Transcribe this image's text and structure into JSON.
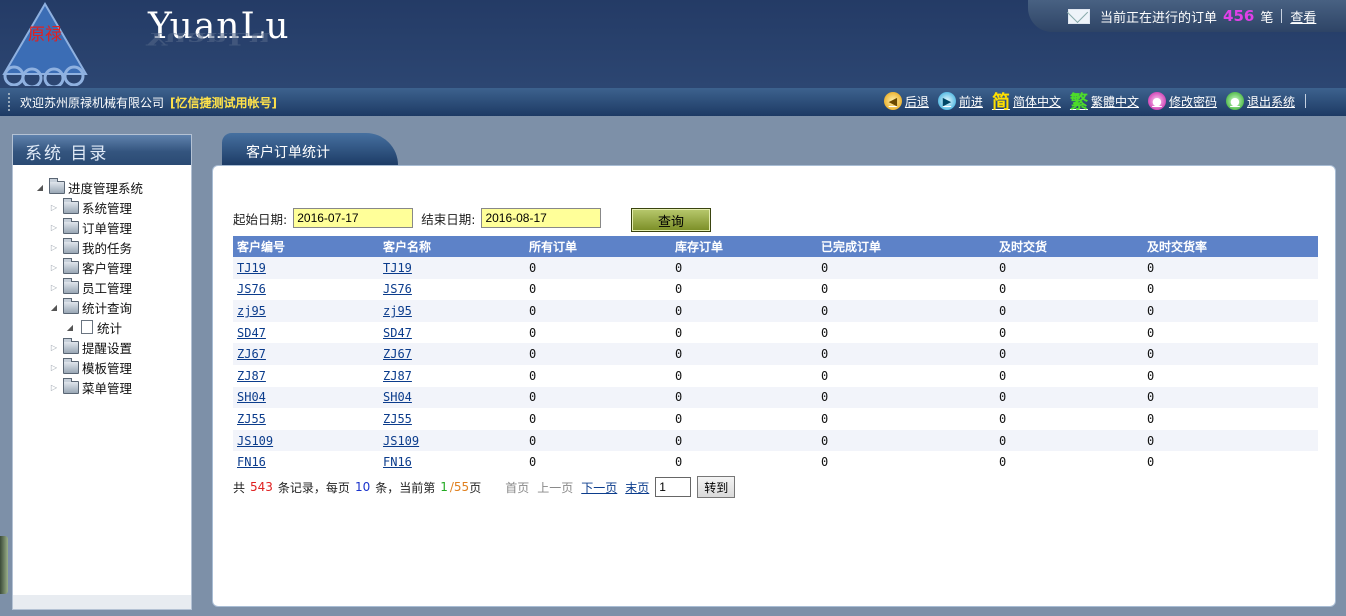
{
  "header": {
    "logo_text": "原禄",
    "brand": "YuanLu",
    "notice": {
      "text": "当前正在进行的订单",
      "count": "456",
      "unit": "笔",
      "view_link": "查看"
    }
  },
  "navbar": {
    "welcome": "欢迎苏州原禄机械有限公司",
    "account": "[忆信捷测试用帐号]",
    "links": {
      "back": "后退",
      "forward": "前进",
      "simplified_icon": "简",
      "simplified": "简体中文",
      "traditional_icon": "繁",
      "traditional": "繁體中文",
      "change_password": "修改密码",
      "logout": "退出系统"
    }
  },
  "sidebar": {
    "title": "系统 目录",
    "root": "进度管理系统",
    "items": {
      "system": "系统管理",
      "orders": "订单管理",
      "tasks": "我的任务",
      "customers": "客户管理",
      "staff": "员工管理",
      "stats": "统计查询",
      "stats_child": "统计",
      "reminders": "提醒设置",
      "templates": "模板管理",
      "menus": "菜单管理"
    }
  },
  "tab": {
    "label": "客户订单统计"
  },
  "filter": {
    "start_label": "起始日期:",
    "start_value": "2016-07-17",
    "end_label": "结束日期:",
    "end_value": "2016-08-17",
    "query_button": "查询"
  },
  "table": {
    "headers": {
      "code": "客户编号",
      "name": "客户名称",
      "all": "所有订单",
      "stock": "库存订单",
      "done": "已完成订单",
      "ontime": "及时交货",
      "rate": "及时交货率"
    },
    "rows": [
      {
        "code": "TJ19",
        "name": "TJ19",
        "all": "0",
        "stock": "0",
        "done": "0",
        "ontime": "0",
        "rate": "0"
      },
      {
        "code": "JS76",
        "name": "JS76",
        "all": "0",
        "stock": "0",
        "done": "0",
        "ontime": "0",
        "rate": "0"
      },
      {
        "code": "zj95",
        "name": "zj95",
        "all": "0",
        "stock": "0",
        "done": "0",
        "ontime": "0",
        "rate": "0"
      },
      {
        "code": "SD47",
        "name": "SD47",
        "all": "0",
        "stock": "0",
        "done": "0",
        "ontime": "0",
        "rate": "0"
      },
      {
        "code": "ZJ67",
        "name": "ZJ67",
        "all": "0",
        "stock": "0",
        "done": "0",
        "ontime": "0",
        "rate": "0"
      },
      {
        "code": "ZJ87",
        "name": "ZJ87",
        "all": "0",
        "stock": "0",
        "done": "0",
        "ontime": "0",
        "rate": "0"
      },
      {
        "code": "SH04",
        "name": "SH04",
        "all": "0",
        "stock": "0",
        "done": "0",
        "ontime": "0",
        "rate": "0"
      },
      {
        "code": "ZJ55",
        "name": "ZJ55",
        "all": "0",
        "stock": "0",
        "done": "0",
        "ontime": "0",
        "rate": "0"
      },
      {
        "code": "JS109",
        "name": "JS109",
        "all": "0",
        "stock": "0",
        "done": "0",
        "ontime": "0",
        "rate": "0"
      },
      {
        "code": "FN16",
        "name": "FN16",
        "all": "0",
        "stock": "0",
        "done": "0",
        "ontime": "0",
        "rate": "0"
      }
    ]
  },
  "pager": {
    "prefix": "共",
    "total": "543",
    "records_per": "条记录，每页",
    "per_page": "10",
    "current_label": "条，当前第",
    "current": "1",
    "slash": "/",
    "pages": "55",
    "page_suffix": "页",
    "first": "首页",
    "prev": "上一页",
    "next": "下一页",
    "last": "末页",
    "page_input": "1",
    "go_button": "转到"
  },
  "colors": {
    "header_bg": "#243b66",
    "table_header": "#5d82c8",
    "date_input_bg": "#ffff99",
    "account_yellow": "#ffe24a",
    "notice_count": "#e040e8"
  }
}
